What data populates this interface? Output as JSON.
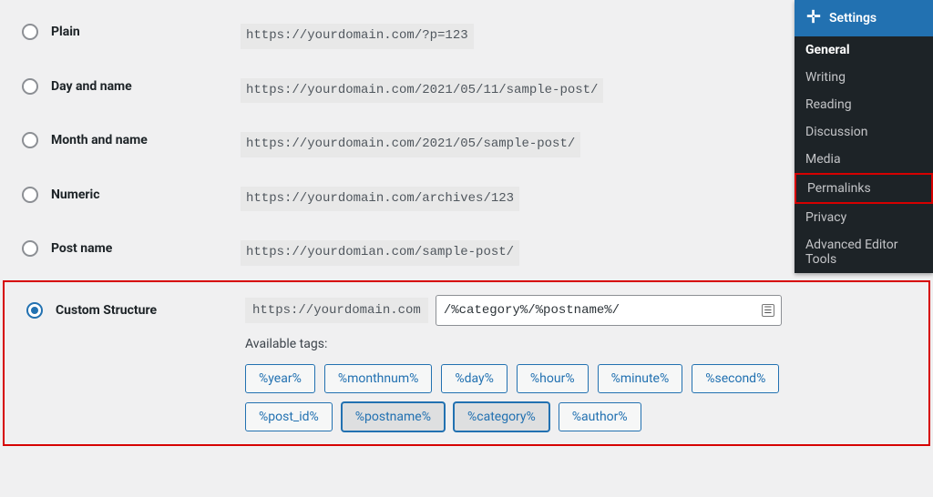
{
  "options": {
    "plain": {
      "label": "Plain",
      "sample": "https://yourdomain.com/?p=123"
    },
    "dayname": {
      "label": "Day and name",
      "sample": "https://yourdomain.com/2021/05/11/sample-post/"
    },
    "month": {
      "label": "Month and name",
      "sample": "https://yourdomain.com/2021/05/sample-post/"
    },
    "numeric": {
      "label": "Numeric",
      "sample": "https://yourdomain.com/archives/123"
    },
    "postname": {
      "label": "Post name",
      "sample": "https://yourdomian.com/sample-post/"
    },
    "custom": {
      "label": "Custom Structure"
    }
  },
  "custom": {
    "prefix": "https://yourdomain.com",
    "input_value": "/%category%/%postname%/",
    "available_label": "Available tags:",
    "tags": [
      "%year%",
      "%monthnum%",
      "%day%",
      "%hour%",
      "%minute%",
      "%second%",
      "%post_id%",
      "%postname%",
      "%category%",
      "%author%"
    ]
  },
  "sidebar": {
    "header": "Settings",
    "items": [
      "General",
      "Writing",
      "Reading",
      "Discussion",
      "Media",
      "Permalinks",
      "Privacy",
      "Advanced Editor Tools"
    ]
  }
}
